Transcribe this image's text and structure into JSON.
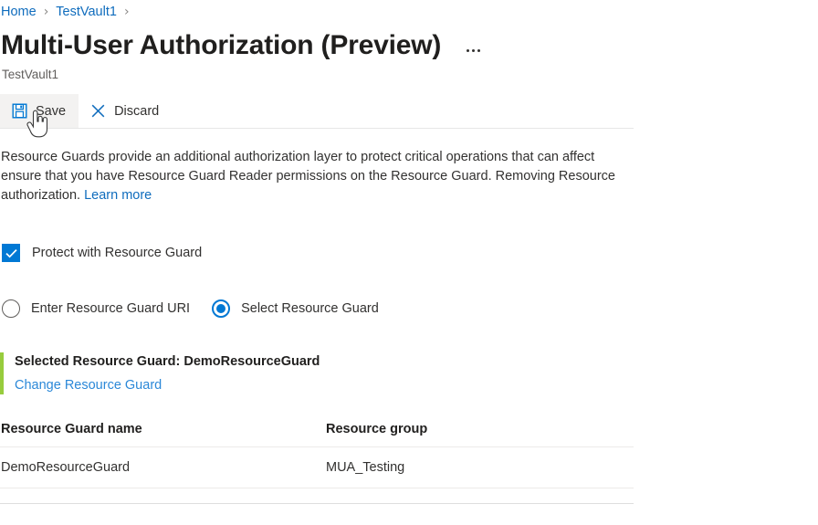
{
  "breadcrumb": {
    "items": [
      {
        "label": "Home"
      },
      {
        "label": "TestVault1"
      }
    ],
    "separator": "›"
  },
  "header": {
    "title": "Multi-User Authorization (Preview)",
    "subtitle": "TestVault1",
    "more_options_label": "More options"
  },
  "commandbar": {
    "buttons": [
      {
        "label": "Save",
        "icon": "save-icon",
        "state": "hovered"
      },
      {
        "label": "Discard",
        "icon": "close-icon",
        "state": "default"
      }
    ]
  },
  "description": {
    "text_part1": "Resource Guards provide an additional authorization layer to protect critical operations that can affect ensure that you have Resource Guard Reader permissions on the Resource Guard. Removing Resource authorization. ",
    "link_label": "Learn more"
  },
  "protect_checkbox": {
    "label": "Protect with Resource Guard",
    "checked": true
  },
  "guard_mode": {
    "options": [
      {
        "label": "Enter Resource Guard URI",
        "selected": false
      },
      {
        "label": "Select Resource Guard",
        "selected": true
      }
    ]
  },
  "selected_guard": {
    "title": "Selected Resource Guard: DemoResourceGuard",
    "change_link": "Change Resource Guard",
    "accent_color": "#97cc3d"
  },
  "table": {
    "columns": [
      "Resource Guard name",
      "Resource group"
    ],
    "rows": [
      {
        "name": "DemoResourceGuard",
        "group": "MUA_Testing"
      }
    ]
  },
  "colors": {
    "link": "#0f6cbd",
    "accent_blue": "#0078d4",
    "text": "#323130",
    "subtle_text": "#605e5c"
  }
}
